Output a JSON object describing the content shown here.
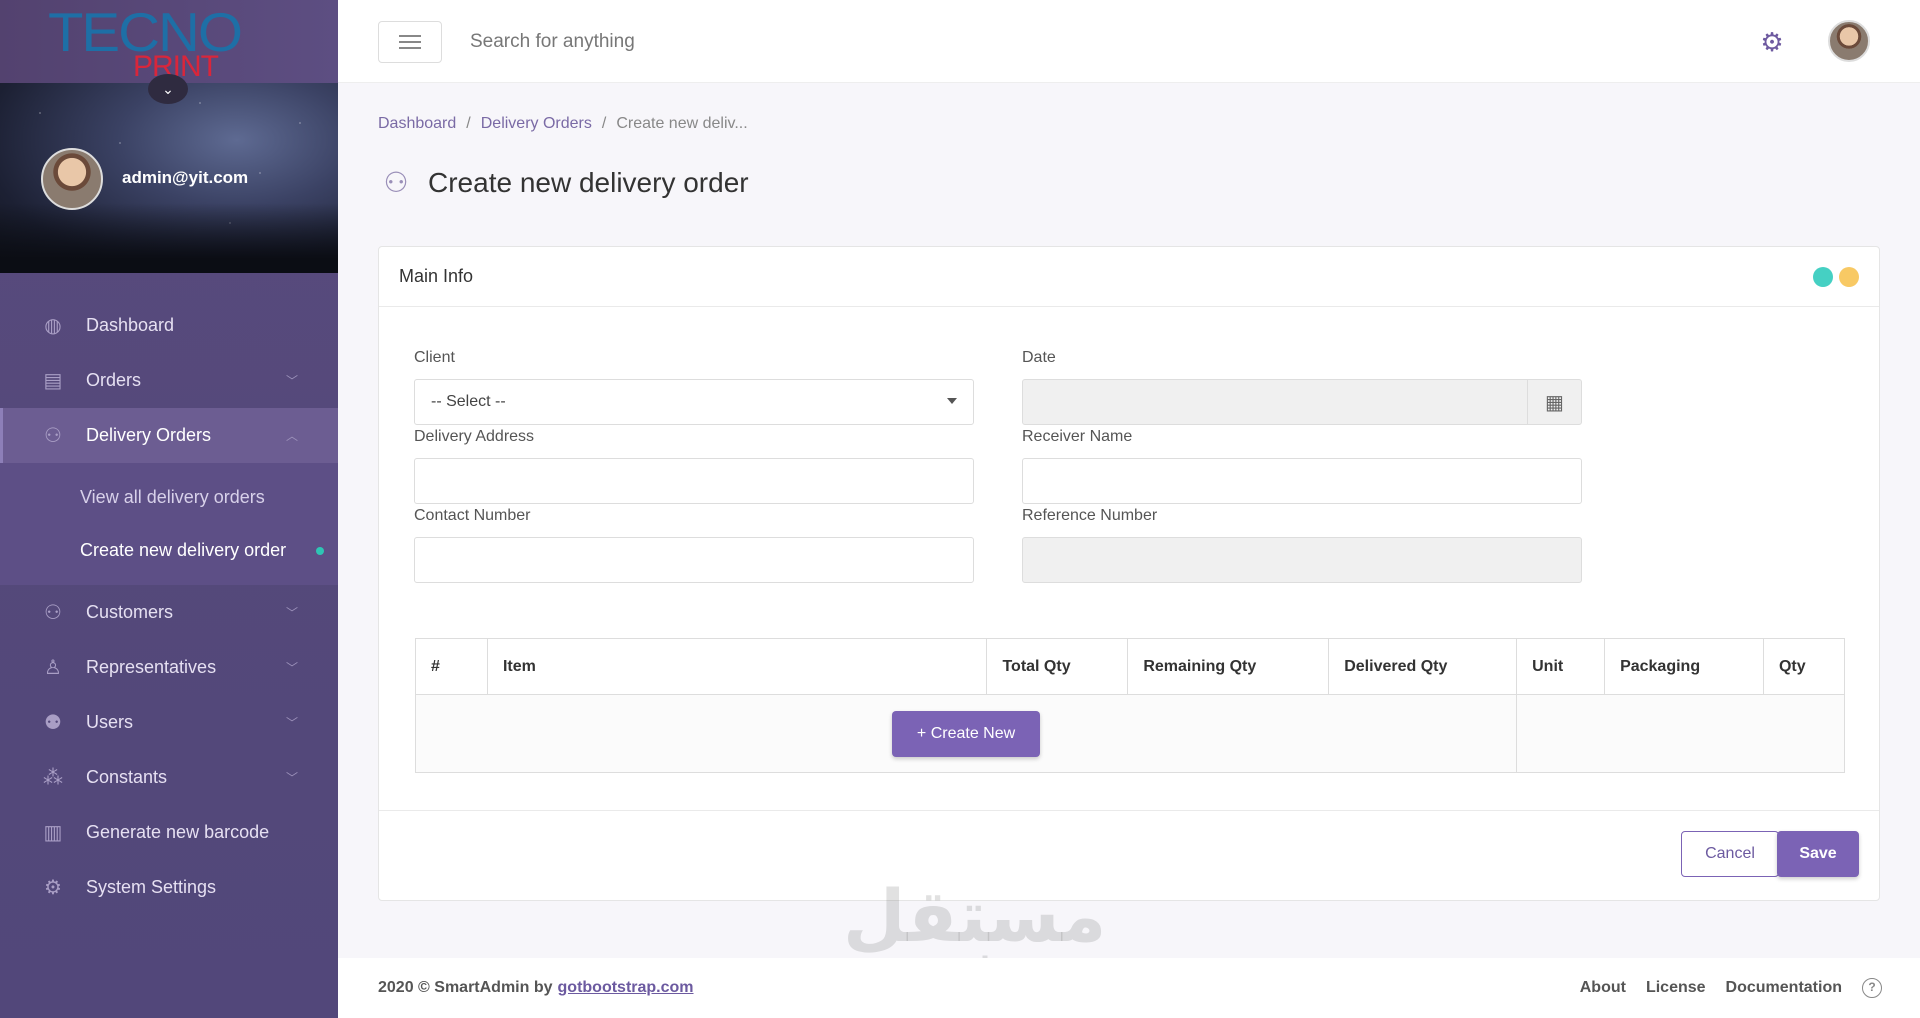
{
  "brand": {
    "line1": "TECNO",
    "line2": "PRINT"
  },
  "profile": {
    "email": "admin@yit.com"
  },
  "nav": {
    "items": [
      {
        "label": "Dashboard",
        "icon": "globe-icon"
      },
      {
        "label": "Orders",
        "icon": "orders-icon"
      },
      {
        "label": "Delivery Orders",
        "icon": "users-icon"
      },
      {
        "label": "Customers",
        "icon": "users-icon"
      },
      {
        "label": "Representatives",
        "icon": "person-icon"
      },
      {
        "label": "Users",
        "icon": "group-icon"
      },
      {
        "label": "Constants",
        "icon": "cubes-icon"
      },
      {
        "label": "Generate new barcode",
        "icon": "barcode-icon"
      },
      {
        "label": "System Settings",
        "icon": "gear-icon"
      }
    ],
    "submenu": [
      {
        "label": "View all delivery orders"
      },
      {
        "label": "Create new delivery order"
      }
    ]
  },
  "topbar": {
    "search_placeholder": "Search for anything"
  },
  "breadcrumb": [
    "Dashboard",
    "Delivery Orders",
    "Create new deliv..."
  ],
  "page": {
    "title": "Create new delivery order"
  },
  "panel": {
    "title": "Main Info",
    "dot_colors": [
      "#45d0c3",
      "#f8c964"
    ],
    "labels": {
      "client": "Client",
      "date": "Date",
      "delivery_address": "Delivery Address",
      "receiver_name": "Receiver Name",
      "contact_number": "Contact Number",
      "reference_number": "Reference Number"
    },
    "client_selected": "-- Select --",
    "table": {
      "columns": [
        "#",
        "Item",
        "Total Qty",
        "Remaining Qty",
        "Delivered Qty",
        "Unit",
        "Packaging",
        "Qty"
      ],
      "create_label": "Create New"
    },
    "cancel_label": "Cancel",
    "save_label": "Save"
  },
  "footer": {
    "copyright": "2020 © SmartAdmin by",
    "link": "gotbootstrap.com",
    "links": [
      "About",
      "License",
      "Documentation"
    ]
  },
  "watermark": {
    "arabic": "مستقل",
    "latin": "mostaql.com"
  },
  "colors": {
    "accent": "#7b63b5",
    "sidebar": "#54497a",
    "active_dot": "#2ec5b4"
  }
}
